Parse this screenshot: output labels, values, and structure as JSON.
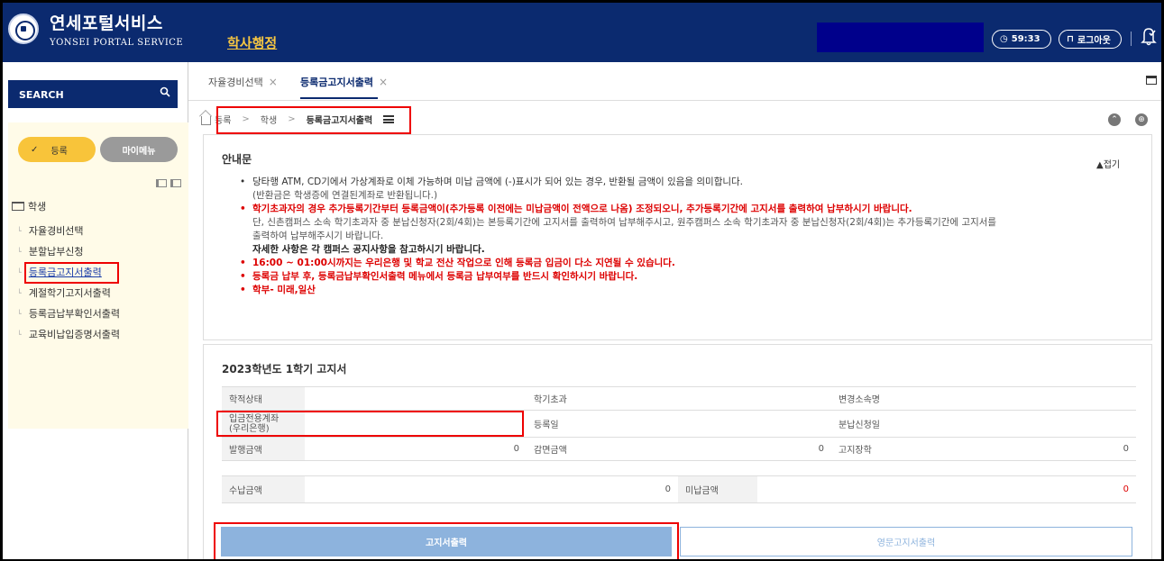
{
  "header": {
    "brand_kr": "연세포털서비스",
    "brand_en": "YONSEI PORTAL SERVICE",
    "nav_item": "학사행정",
    "timer": "59:33",
    "logout": "로그아웃"
  },
  "sidebar": {
    "search_label": "SEARCH",
    "btn_register": "등록",
    "btn_mymenu": "마이메뉴",
    "root": "학생",
    "items": [
      {
        "label": "자율경비선택"
      },
      {
        "label": "분할납부신청"
      },
      {
        "label": "등록금고지서출력"
      },
      {
        "label": "계절학기고지서출력"
      },
      {
        "label": "등록금납부확인서출력"
      },
      {
        "label": "교육비납입증명서출력"
      }
    ]
  },
  "tabs": [
    {
      "label": "자율경비선택"
    },
    {
      "label": "등록금고지서출력"
    }
  ],
  "breadcrumb": [
    "등록",
    "학생",
    "등록금고지서출력"
  ],
  "notice": {
    "title": "안내문",
    "fold": "▲접기",
    "lines": [
      "당타행 ATM, CD기에서 가상계좌로 이체 가능하며 미납 금액에 (-)표시가 되어 있는 경우, 반환될 금액이 있음을 의미합니다.",
      "(반환금은 학생증에 연결된계좌로 반환됩니다.)",
      "학기초과자의 경우 추가등록기간부터 등록금액이(추가등록 이전에는 미납금액이 전액으로 나옴) 조정되오니, 추가등록기간에 고지서를 출력하여 납부하시기 바랍니다.",
      "단, 신촌캠퍼스 소속 학기초과자 중 분납신청자(2회/4회)는 본등록기간에 고지서를 출력하여 납부해주시고, 원주캠퍼스 소속 학기초과자 중 분납신청자(2회/4회)는 추가등록기간에 고지서를",
      "출력하여 납부해주시기 바랍니다.",
      "자세한 사항은 각 캠퍼스 공지사항을 참고하시기 바랍니다.",
      "16:00 ~ 01:00시까지는 우리은행 및 학교 전산 작업으로 인해 등록금 입금이 다소 지연될 수 있습니다.",
      "등록금 납부 후, 등록금납부확인서출력 메뉴에서 등록금 납부여부를 반드시 확인하시기 바랍니다.",
      "학부- 미래,일산"
    ]
  },
  "bill": {
    "title": "2023학년도 1학기 고지서",
    "labels": {
      "status": "학적상태",
      "exceed": "학기초과",
      "change": "변경소속명",
      "account": "입금전용계좌\n(우리은행)",
      "regdate": "등록일",
      "installment": "분납신청일",
      "issued": "발행금액",
      "reduced": "감면금액",
      "scholar": "고지장학",
      "paid": "수납금액",
      "unpaid": "미납금액"
    },
    "values": {
      "issued": "0",
      "reduced": "0",
      "scholar": "0",
      "paid": "0",
      "unpaid": "0"
    },
    "btn_print": "고지서출력",
    "btn_english": "영문고지서출력"
  }
}
